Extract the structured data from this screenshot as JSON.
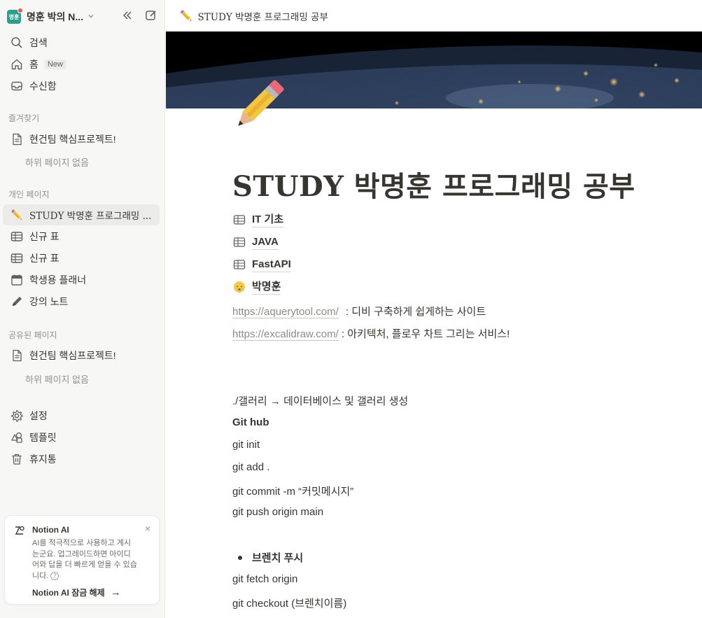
{
  "workspace": {
    "avatar_text": "명훈",
    "name": "명훈 박의 N..."
  },
  "sidebar": {
    "top_items": [
      {
        "label": "검색",
        "icon": "search-icon"
      },
      {
        "label": "홈",
        "icon": "home-icon",
        "badge": "New"
      },
      {
        "label": "수신함",
        "icon": "inbox-icon"
      }
    ],
    "favorites_label": "즐겨찾기",
    "favorites": [
      {
        "label": "현건팀 핵심프로젝트!",
        "sub_empty": "하위 페이지 없음"
      }
    ],
    "private_label": "개인 페이지",
    "private": [
      {
        "label": "STUDY 박명훈 프로그래밍 ...",
        "icon": "pencil-emoji-icon",
        "glyph": "✏️"
      },
      {
        "label": "신규 표",
        "icon": "table-icon"
      },
      {
        "label": "신규 표",
        "icon": "table-icon"
      },
      {
        "label": "학생용 플래너",
        "icon": "calendar-icon"
      },
      {
        "label": "강의 노트",
        "icon": "pen-icon"
      }
    ],
    "shared_label": "공유된 페이지",
    "shared": [
      {
        "label": "현건팀 핵심프로젝트!",
        "sub_empty": "하위 페이지 없음"
      }
    ],
    "bottom_items": [
      {
        "label": "설정",
        "icon": "gear-icon"
      },
      {
        "label": "템플릿",
        "icon": "template-icon"
      },
      {
        "label": "휴지통",
        "icon": "trash-icon"
      }
    ],
    "ai_card": {
      "title": "Notion AI",
      "body": "AI를 적극적으로 사용하고 계시는군요. 업그레이드하면 아이디어와 답을 더 빠르게 얻을 수 있습니다.",
      "help": "?",
      "link": "Notion AI 잠금 해제",
      "arrow": "→",
      "close": "×"
    }
  },
  "topbar": {
    "icon": "✏️",
    "breadcrumb": "STUDY 박명훈 프로그래밍 공부"
  },
  "page": {
    "icon": "✏️",
    "title": "STUDY 박명훈 프로그래밍 공부",
    "db_links": [
      {
        "label": "IT 기초",
        "icon": "table-icon"
      },
      {
        "label": "JAVA",
        "icon": "table-icon"
      },
      {
        "label": "FastAPI",
        "icon": "table-icon"
      },
      {
        "label": "박명훈",
        "icon": "sleepy-face-icon",
        "glyph": "😴"
      }
    ],
    "links": [
      {
        "url": "https://aquerytool.com/",
        "desc": " : 디비 구축하게 쉽게하는 사이트"
      },
      {
        "url": "https://excalidraw.com/",
        "desc": " : 아키텍처, 플로우 차트 그리는 서비스!"
      }
    ],
    "lines": [
      "./갤러리 → 데이터베이스 및 갤러리 생성",
      "Git hub",
      "git init",
      "git add .",
      "git commit -m “커밋메시지”",
      "git push origin main"
    ],
    "bullet": "브렌치 푸시",
    "after_bullet": [
      "git fetch origin",
      "git checkout (브렌치이름)"
    ]
  }
}
